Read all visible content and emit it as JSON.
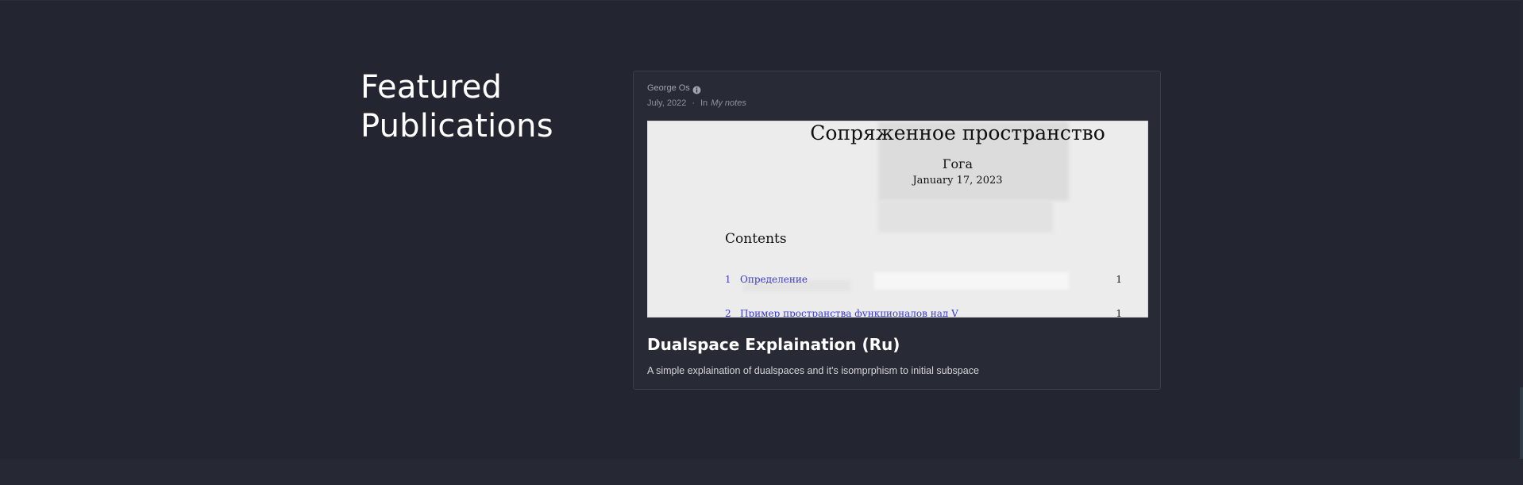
{
  "section": {
    "title": "Featured Publications"
  },
  "publication": {
    "author": "George Os",
    "date": "July, 2022",
    "separator": "·",
    "in_label": "In",
    "publication_name": "My notes",
    "title": "Dualspace Explaination (Ru)",
    "summary": "A simple explaination of dualspaces and it's isomprphism to initial subspace",
    "thumbnail": {
      "doc_title": "Сопряженное пространство",
      "doc_author": "Гога",
      "doc_date": "January 17, 2023",
      "contents_heading": "Contents",
      "toc": [
        {
          "num": "1",
          "text": "Определение",
          "page": "1"
        },
        {
          "num": "2",
          "text": "Пример пространства функционалов над V",
          "page": "1"
        }
      ]
    }
  },
  "colors": {
    "background": "#232530",
    "card": "#282a36",
    "link": "#3a3ad0"
  },
  "icons": {
    "info": "info-circle-icon"
  }
}
